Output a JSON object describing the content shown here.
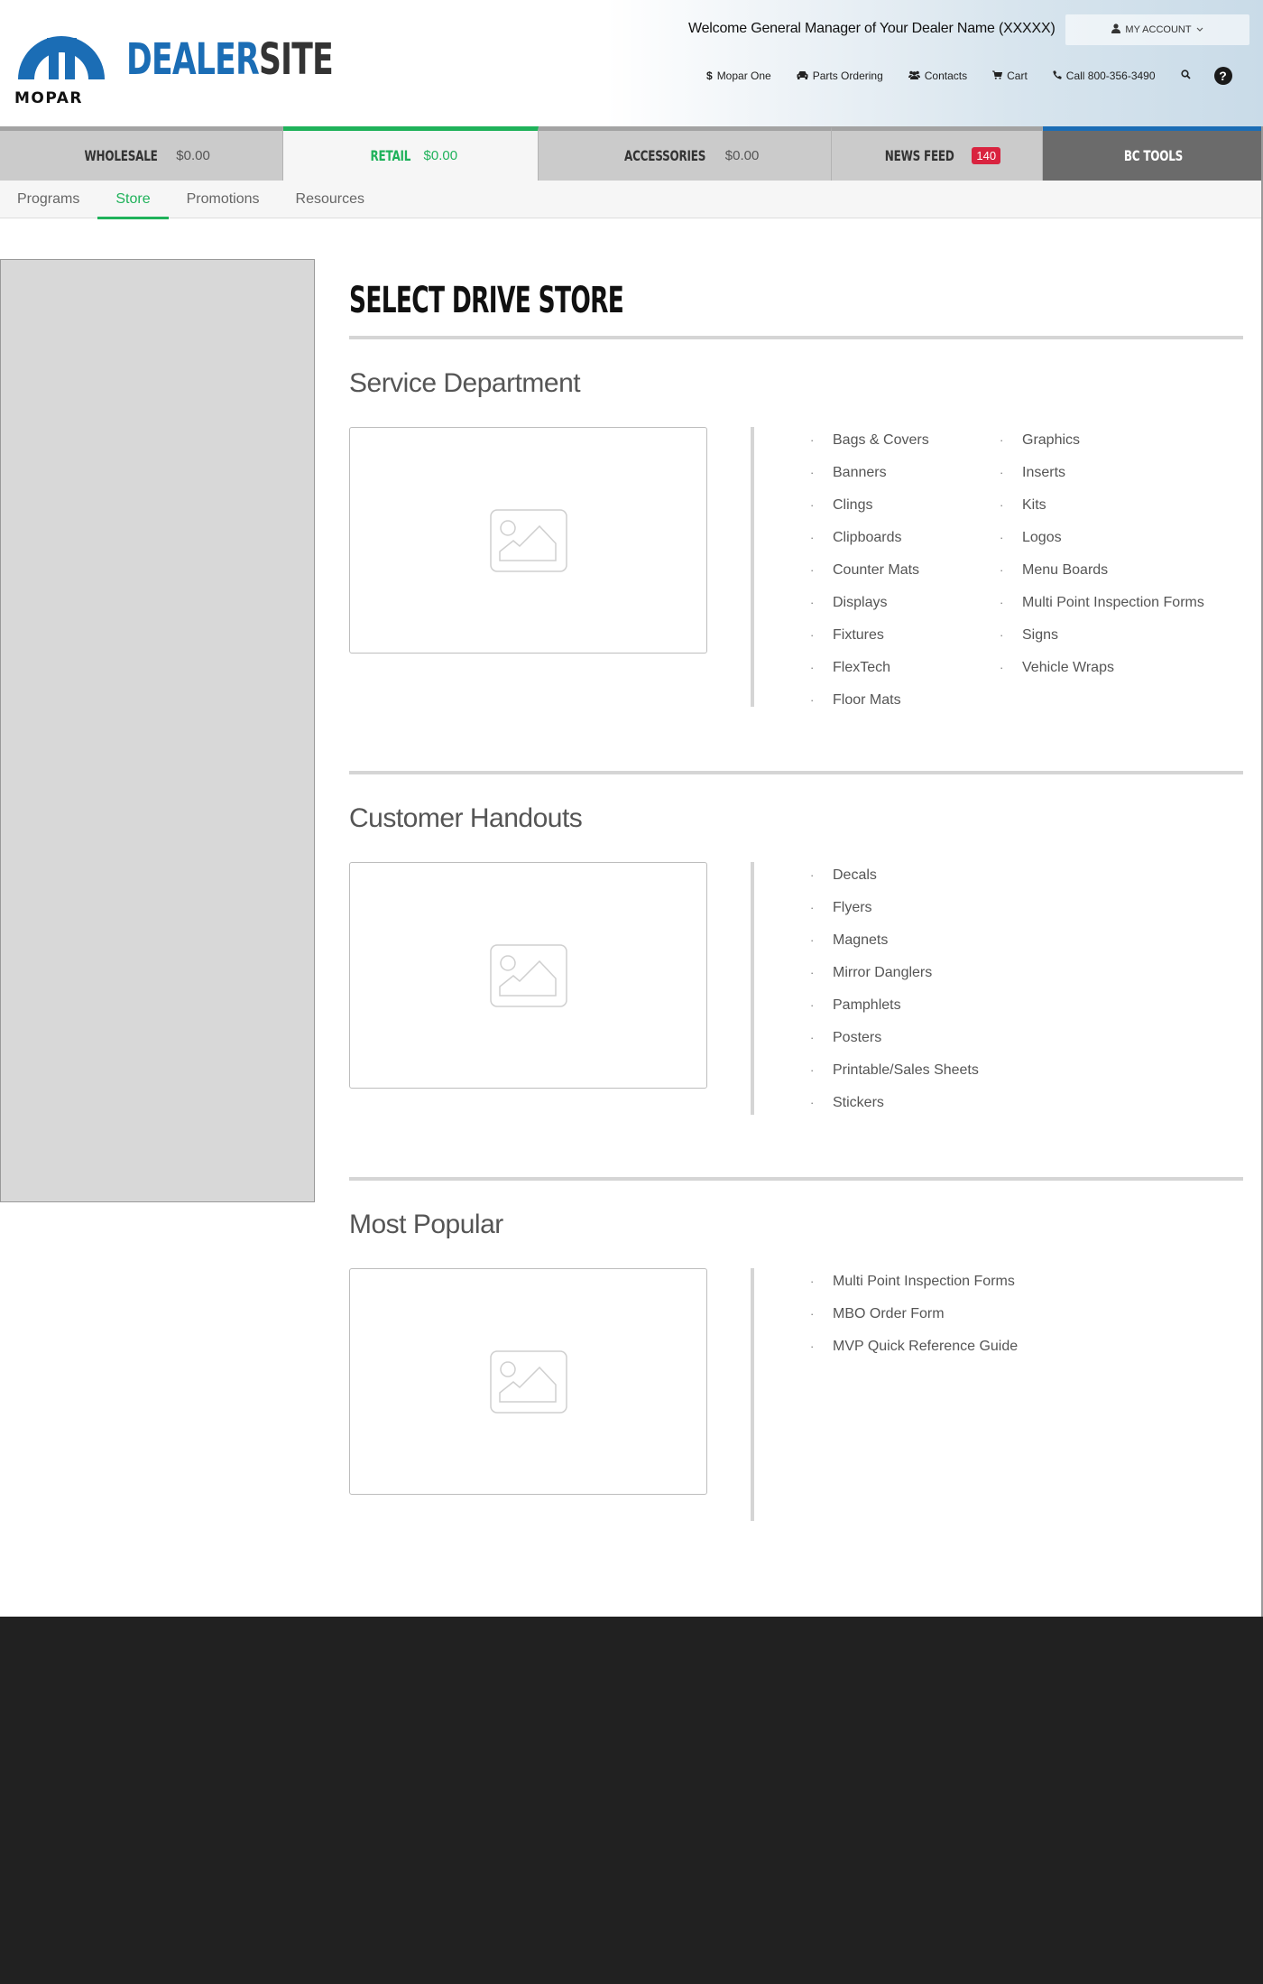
{
  "header": {
    "brand_part1": "DEALER",
    "brand_part2": "SITE",
    "logo_text": "MOPAR",
    "welcome": "Welcome General Manager of  Your Dealer Name (XXXXX)",
    "account_button": "MY ACCOUNT",
    "util_nav": [
      {
        "icon": "dollar-icon",
        "label": "Mopar One"
      },
      {
        "icon": "car-icon",
        "label": "Parts Ordering"
      },
      {
        "icon": "users-icon",
        "label": "Contacts"
      },
      {
        "icon": "cart-icon",
        "label": "Cart"
      },
      {
        "icon": "phone-icon",
        "label": "Call 800-356-3490"
      }
    ]
  },
  "tabs": [
    {
      "label": "WHOLESALE",
      "value": "$0.00",
      "active": false
    },
    {
      "label": "RETAIL",
      "value": "$0.00",
      "active": true
    },
    {
      "label": "ACCESSORIES",
      "value": "$0.00",
      "active": false
    },
    {
      "label": "NEWS FEED",
      "badge": "140",
      "active": false
    },
    {
      "label": "BC TOOLS",
      "active": false
    }
  ],
  "subnav": [
    {
      "label": "Programs",
      "active": false
    },
    {
      "label": "Store",
      "active": true
    },
    {
      "label": "Promotions",
      "active": false
    },
    {
      "label": "Resources",
      "active": false
    }
  ],
  "page_title": "SELECT DRIVE STORE",
  "sections": [
    {
      "title": "Service Department",
      "col1": [
        "Bags & Covers",
        "Banners",
        "Clings",
        "Clipboards",
        "Counter Mats",
        "Displays",
        "Fixtures",
        "FlexTech",
        "Floor Mats"
      ],
      "col2": [
        "Graphics",
        "Inserts",
        "Kits",
        "Logos",
        "Menu Boards",
        "Multi Point Inspection Forms",
        "Signs",
        "Vehicle Wraps"
      ]
    },
    {
      "title": "Customer Handouts",
      "col1": [
        "Decals",
        "Flyers",
        "Magnets",
        "Mirror Danglers",
        "Pamphlets",
        "Posters",
        "Printable/Sales Sheets",
        "Stickers"
      ]
    },
    {
      "title": "Most Popular",
      "col1": [
        "Multi Point Inspection Forms",
        "MBO Order Form",
        "MVP Quick Reference Guide"
      ]
    }
  ],
  "colors": {
    "brand_blue": "#1b6db5",
    "active_green": "#1fb25a",
    "badge_red": "#d9233f",
    "footer": "#212121"
  },
  "bullet": "·"
}
